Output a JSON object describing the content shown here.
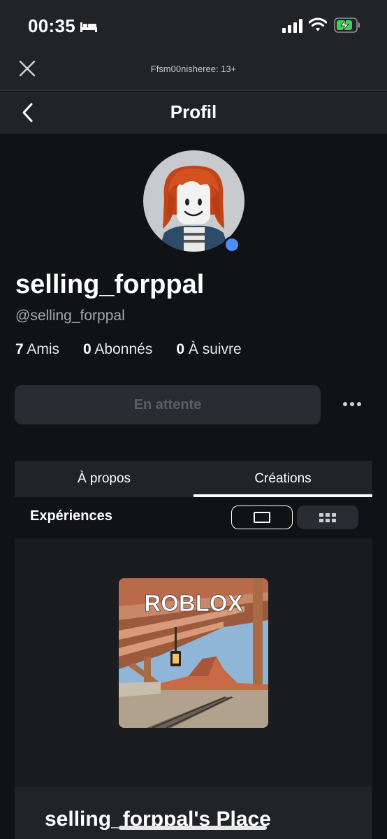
{
  "status_bar": {
    "time": "00:35",
    "icons": [
      "bed-icon",
      "signal-icon",
      "wifi-icon",
      "battery-charging-icon"
    ],
    "battery_color": "#3cd15a"
  },
  "chrome": {
    "title": "Ffsm00nisheree: 13+",
    "close_icon": "close-icon"
  },
  "header": {
    "title": "Profil",
    "back_icon": "chevron-left-icon"
  },
  "profile": {
    "display_name": "selling_forppal",
    "handle": "@selling_forppal",
    "online_color": "#4d8ef6",
    "stats": [
      {
        "count": "7",
        "label": "Amis"
      },
      {
        "count": "0",
        "label": "Abonnés"
      },
      {
        "count": "0",
        "label": "À suivre"
      }
    ],
    "pending_button": "En attente",
    "more_icon": "more-horizontal-icon"
  },
  "tabs": [
    {
      "label": "À propos",
      "active": false
    },
    {
      "label": "Créations",
      "active": true
    }
  ],
  "section": {
    "title": "Expériences",
    "view_modes": [
      {
        "icon": "single-view-icon",
        "active": true
      },
      {
        "icon": "grid-view-icon",
        "active": false
      }
    ]
  },
  "experience": {
    "thumbnail_logo": "ROBLOX",
    "name": "selling_forppal's Place"
  }
}
